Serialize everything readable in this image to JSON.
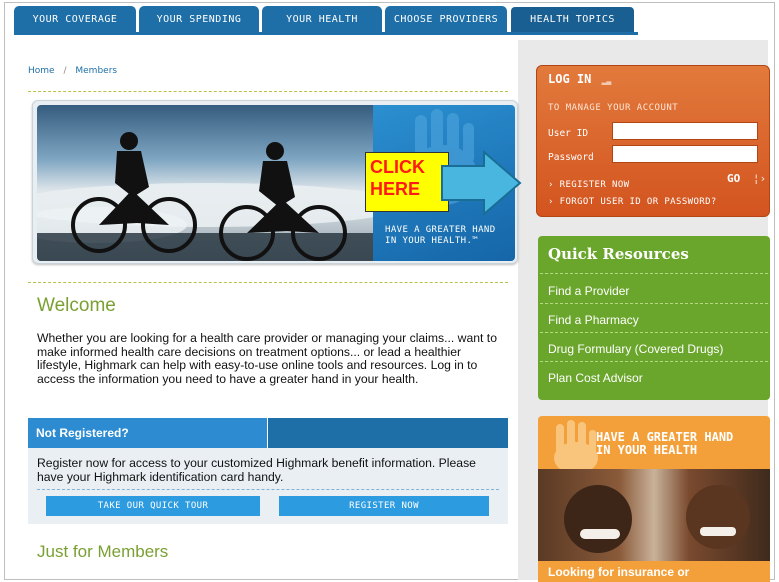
{
  "nav": {
    "tabs": [
      {
        "label": "YOUR COVERAGE"
      },
      {
        "label": "YOUR SPENDING"
      },
      {
        "label": "YOUR HEALTH"
      },
      {
        "label": "CHOOSE PROVIDERS"
      },
      {
        "label": "HEALTH TOPICS"
      }
    ]
  },
  "breadcrumb": {
    "home": "Home",
    "sep": "/",
    "current": "Members"
  },
  "hero": {
    "tagline_line1": "HAVE A GREATER HAND",
    "tagline_line2": "IN YOUR HEALTH.™",
    "callout_line1": "CLICK",
    "callout_line2": "HERE"
  },
  "welcome": {
    "title": "Welcome",
    "body": "Whether you are looking for a health care provider or managing your claims... want to make informed health care decisions on treatment options... or lead a healthier lifestyle, Highmark can help with easy-to-use online tools and resources. Log in to access the information you need to have a greater hand in your health."
  },
  "not_registered": {
    "title": "Not Registered?",
    "body": "Register now for access to your customized Highmark benefit information. Please have your Highmark identification card handy.",
    "tour_button": "TAKE OUR QUICK TOUR",
    "register_button": "REGISTER NOW"
  },
  "just_for_members": {
    "title": "Just for Members"
  },
  "login": {
    "title": "LOG IN",
    "subtitle": "TO MANAGE YOUR ACCOUNT",
    "user_label": "User ID",
    "password_label": "Password",
    "user_value": "",
    "password_value": "",
    "register_link": "› REGISTER NOW",
    "forgot_link": "› FORGOT USER ID OR PASSWORD?",
    "go_button": "GO"
  },
  "quick_resources": {
    "title": "Quick Resources",
    "items": [
      {
        "label": "Find a Provider"
      },
      {
        "label": "Find a Pharmacy"
      },
      {
        "label": "Drug Formulary (Covered Drugs)"
      },
      {
        "label": "Plan Cost Advisor"
      }
    ]
  },
  "promo": {
    "title_line1": "HAVE A GREATER HAND",
    "title_line2": "IN YOUR HEALTH",
    "bottom": "Looking for insurance or"
  },
  "colors": {
    "nav_blue": "#1e6fa8",
    "welcome_green": "#7aa033",
    "login_orange": "#d3541f",
    "resources_green": "#6aa62c",
    "promo_orange": "#f4a03a",
    "callout_yellow": "#ffff00",
    "callout_red": "#ff1a1a"
  }
}
